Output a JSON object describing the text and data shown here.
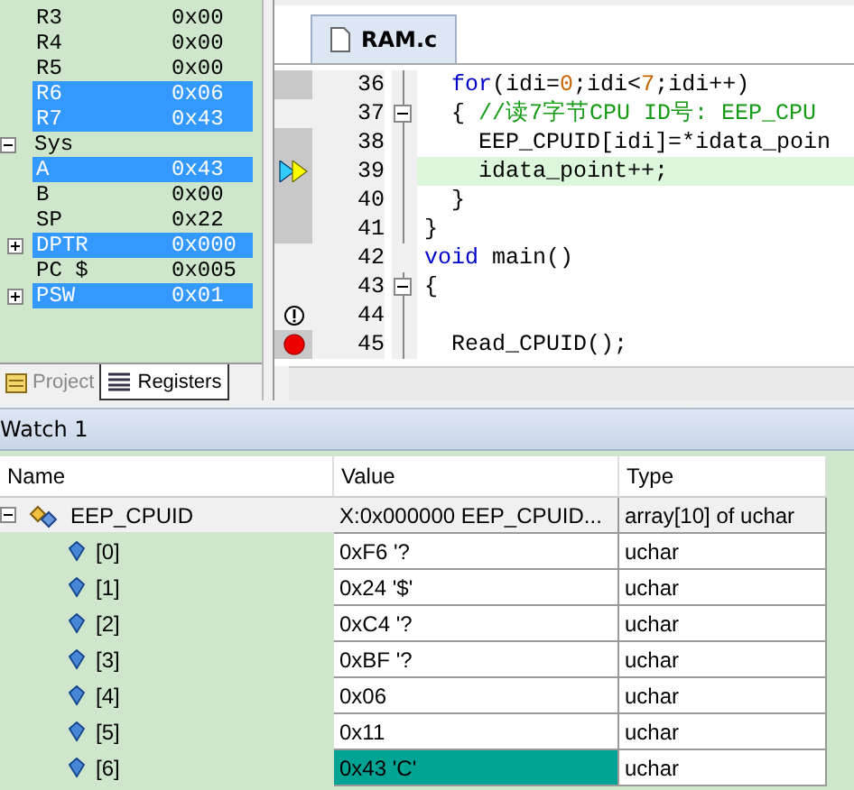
{
  "registers": {
    "groups": [
      {
        "children": [
          {
            "name": "R3",
            "value": "0x00",
            "selected": false
          },
          {
            "name": "R4",
            "value": "0x00",
            "selected": false
          },
          {
            "name": "R5",
            "value": "0x00",
            "selected": false
          },
          {
            "name": "R6",
            "value": "0x06",
            "selected": true
          },
          {
            "name": "R7",
            "value": "0x43",
            "selected": true
          }
        ]
      },
      {
        "name": "Sys",
        "expanded": true,
        "children": [
          {
            "name": "A",
            "value": "0x43",
            "selected": true
          },
          {
            "name": "B",
            "value": "0x00",
            "selected": false
          },
          {
            "name": "SP",
            "value": "0x22",
            "selected": false
          },
          {
            "name": "DPTR",
            "value": "0x000",
            "selected": true,
            "expanded": false
          },
          {
            "name": "PC $",
            "value": "0x005",
            "selected": false
          },
          {
            "name": "PSW",
            "value": "0x01",
            "selected": true,
            "expanded": false
          }
        ]
      }
    ]
  },
  "panel_tabs": [
    {
      "label": "Project",
      "selected": false
    },
    {
      "label": "Registers",
      "selected": true
    }
  ],
  "editor": {
    "tab": "RAM.c",
    "lines": [
      {
        "number": "36",
        "executed": true,
        "current": false,
        "breakpoint": false,
        "warning": false,
        "collapsible": false,
        "in_block": true,
        "segments": [
          {
            "kind": "keyword",
            "t": "  for"
          },
          {
            "kind": "plain",
            "t": "(idi="
          },
          {
            "kind": "number",
            "t": "0"
          },
          {
            "kind": "plain",
            "t": ";idi<"
          },
          {
            "kind": "number",
            "t": "7"
          },
          {
            "kind": "plain",
            "t": ";idi++)"
          }
        ]
      },
      {
        "number": "37",
        "executed": false,
        "current": false,
        "breakpoint": false,
        "warning": false,
        "collapsible": true,
        "in_block": true,
        "segments": [
          {
            "kind": "plain",
            "t": "  { "
          },
          {
            "kind": "comment",
            "t": "//读7字节CPU ID号: EEP_CPU"
          }
        ]
      },
      {
        "number": "38",
        "executed": true,
        "current": false,
        "breakpoint": false,
        "warning": false,
        "collapsible": false,
        "in_block": true,
        "segments": [
          {
            "kind": "plain",
            "t": "    EEP_CPUID[idi]=*idata_poin"
          }
        ]
      },
      {
        "number": "39",
        "executed": true,
        "current": true,
        "breakpoint": false,
        "warning": false,
        "collapsible": false,
        "in_block": true,
        "segments": [
          {
            "kind": "plain",
            "t": "    idata_point++;"
          }
        ]
      },
      {
        "number": "40",
        "executed": true,
        "current": false,
        "breakpoint": false,
        "warning": false,
        "collapsible": false,
        "in_block": true,
        "segments": [
          {
            "kind": "plain",
            "t": "  }"
          }
        ]
      },
      {
        "number": "41",
        "executed": true,
        "current": false,
        "breakpoint": false,
        "warning": false,
        "collapsible": false,
        "in_block": true,
        "segments": [
          {
            "kind": "plain",
            "t": "}"
          }
        ]
      },
      {
        "number": "42",
        "executed": false,
        "current": false,
        "breakpoint": false,
        "warning": false,
        "collapsible": false,
        "in_block": false,
        "segments": [
          {
            "kind": "keyword",
            "t": "void"
          },
          {
            "kind": "plain",
            "t": " main()"
          }
        ]
      },
      {
        "number": "43",
        "executed": false,
        "current": false,
        "breakpoint": false,
        "warning": false,
        "collapsible": true,
        "in_block": true,
        "segments": [
          {
            "kind": "plain",
            "t": "{"
          }
        ]
      },
      {
        "number": "44",
        "executed": false,
        "current": false,
        "breakpoint": false,
        "warning": true,
        "collapsible": false,
        "in_block": true
      },
      {
        "number": "45",
        "executed": true,
        "current": false,
        "breakpoint": true,
        "warning": false,
        "collapsible": false,
        "in_block": true,
        "segments": [
          {
            "kind": "plain",
            "t": "  Read_CPUID();"
          }
        ]
      }
    ]
  },
  "watch": {
    "title": "Watch 1",
    "columns": [
      "Name",
      "Value",
      "Type"
    ],
    "root": {
      "name": "EEP_CPUID",
      "value": "X:0x000000 EEP_CPUID...",
      "type": "array[10] of uchar",
      "expanded": true
    },
    "rows": [
      {
        "name": "[0]",
        "value": "0xF6 '?",
        "type": "uchar",
        "changed": false
      },
      {
        "name": "[1]",
        "value": "0x24 '$'",
        "type": "uchar",
        "changed": false
      },
      {
        "name": "[2]",
        "value": "0xC4 '?",
        "type": "uchar",
        "changed": false
      },
      {
        "name": "[3]",
        "value": "0xBF '?",
        "type": "uchar",
        "changed": false
      },
      {
        "name": "[4]",
        "value": "0x06",
        "type": "uchar",
        "changed": false
      },
      {
        "name": "[5]",
        "value": "0x11",
        "type": "uchar",
        "changed": false
      },
      {
        "name": "[6]",
        "value": "0x43 'C'",
        "type": "uchar",
        "changed": true
      }
    ]
  }
}
